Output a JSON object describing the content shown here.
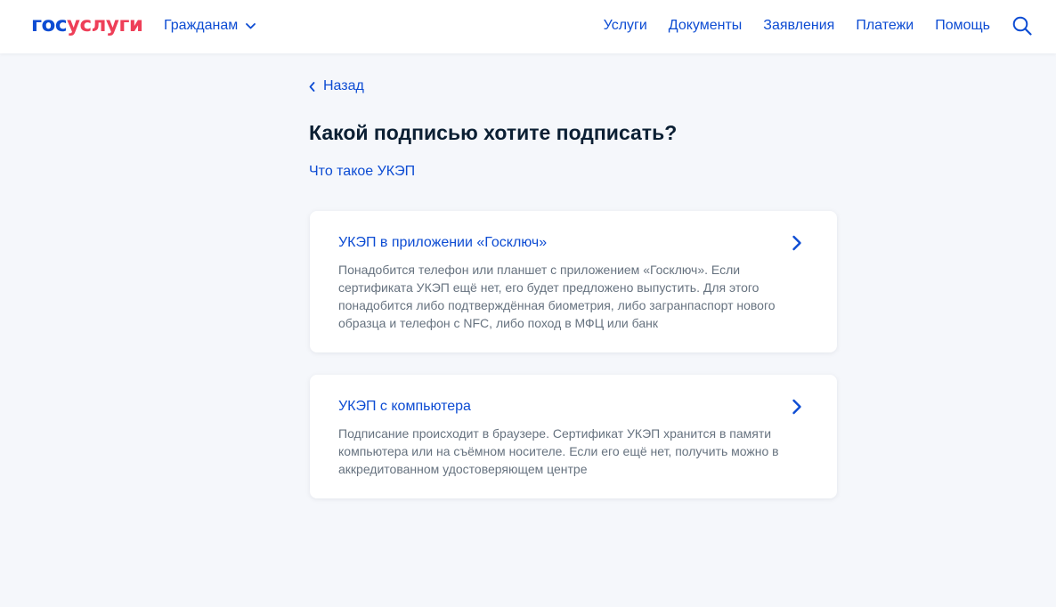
{
  "header": {
    "logo_part1": "гос",
    "logo_part2": "услуги",
    "role_selector": "Гражданам",
    "nav": [
      "Услуги",
      "Документы",
      "Заявления",
      "Платежи",
      "Помощь"
    ]
  },
  "main": {
    "back_label": "Назад",
    "title": "Какой подписью хотите подписать?",
    "info_link": "Что такое УКЭП",
    "options": [
      {
        "title": "УКЭП в приложении «Госключ»",
        "description": "Понадобится телефон или планшет с приложением «Госключ». Если сертификата УКЭП ещё нет, его будет предложено выпустить. Для этого понадобится либо подтверждённая биометрия, либо загранпаспорт нового образца и телефон с NFC, либо поход в МФЦ или банк"
      },
      {
        "title": "УКЭП с компьютера",
        "description": "Подписание происходит в браузере. Сертификат УКЭП хранится в памяти компьютера или на съёмном носителе. Если его ещё нет, получить можно в аккредитованном удостоверяющем центре"
      }
    ]
  },
  "colors": {
    "accent": "#0d4cd3",
    "logo_red": "#ee3f58",
    "text_primary": "#0b1f33",
    "text_secondary": "#66727f",
    "page_background": "#f5f7fb"
  },
  "icons": [
    "chevron-down-icon",
    "search-icon",
    "chevron-left-icon",
    "chevron-right-icon"
  ]
}
